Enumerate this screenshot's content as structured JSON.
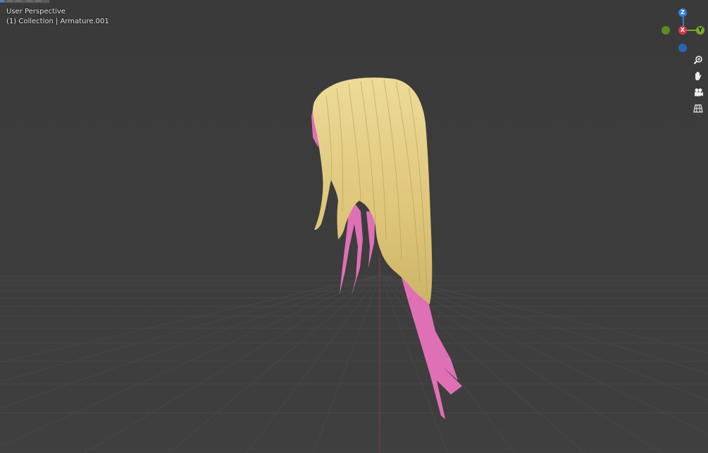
{
  "viewport": {
    "mode_label": "User Perspective",
    "object_label": "(1) Collection | Armature.001"
  },
  "gizmo": {
    "z_label": "Z",
    "x_label": "X",
    "y_label": "Y",
    "colors": {
      "z": "#2f7fd6",
      "x": "#e0344a",
      "y": "#7aa72a",
      "neg_y": "#5d8a23",
      "neg_z": "#2a66ad"
    }
  },
  "navigation": {
    "buttons": [
      {
        "icon": "zoom-icon"
      },
      {
        "icon": "hand-pan-icon"
      },
      {
        "icon": "camera-icon"
      },
      {
        "icon": "grid-ortho-icon"
      }
    ]
  },
  "scene": {
    "hair_color": "#e6cf86",
    "hair_tip_color": "#e070b5",
    "background": "#3d3d3d",
    "grid_line": "#4a4a4a",
    "y_axis_line": "#8a3a46"
  }
}
